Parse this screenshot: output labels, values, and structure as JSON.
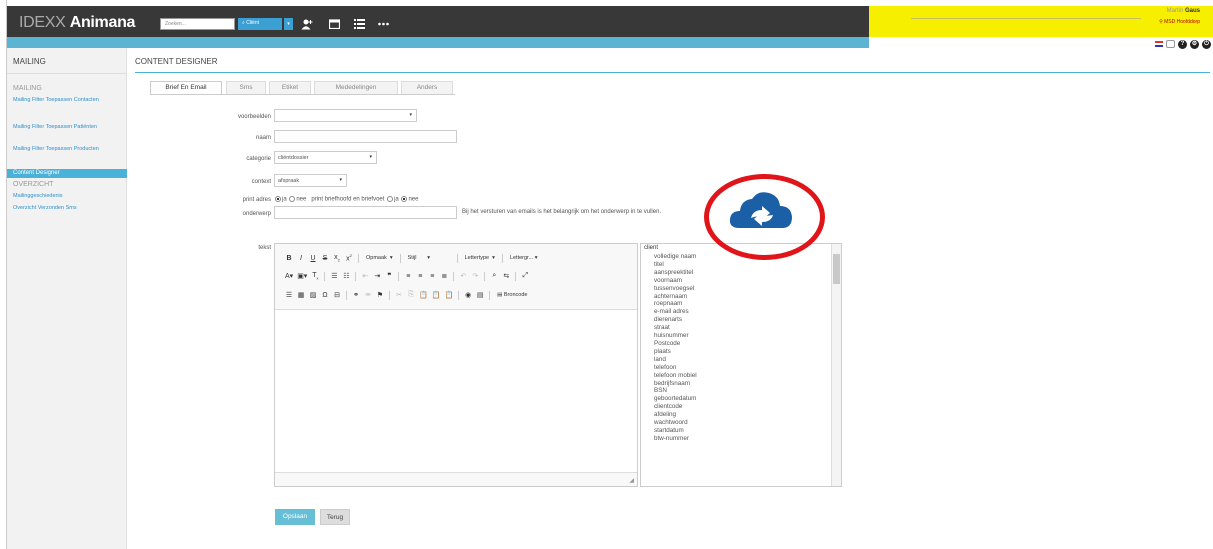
{
  "app": {
    "logo_light": "IDEXX",
    "logo_bold": "Animana"
  },
  "header": {
    "search_placeholder": "Zoeken...",
    "search_scope": "Cliënt",
    "user_first": "Martin",
    "user_last": "Gaus",
    "location": "MSD Hoofddorp"
  },
  "sidebar": {
    "header": "MAILING",
    "group1": "MAILING",
    "links1": [
      "Mailing Filter Toepassen Contacten",
      "Mailing Filter Toepassen Patiënten",
      "Mailing Filter Toepassen Producten"
    ],
    "active": "Content Designer",
    "group2": "OVERZICHT",
    "links2": [
      "Mailinggeschiedenis",
      "Overzicht Verzonden Sms"
    ]
  },
  "main": {
    "title": "CONTENT DESIGNER",
    "tabs": [
      "Brief En Email",
      "Sms",
      "Etiket",
      "Mededelingen",
      "Anders"
    ]
  },
  "form": {
    "voorbeelden_label": "voorbeelden",
    "naam_label": "naam",
    "categorie_label": "categorie",
    "categorie_value": "cliëntdossier",
    "context_label": "context",
    "context_value": "afspraak",
    "print_adres_label": "print adres",
    "ja": "ja",
    "nee": "nee",
    "print_briefhoofd_label": "print briefhoofd en briefvoet",
    "onderwerp_label": "onderwerp",
    "onderwerp_hint": "Bij het versturen van emails is het belangrijk om het onderwerp in te vullen.",
    "tekst_label": "tekst"
  },
  "toolbar": {
    "opmaak": "Opmaak",
    "stijl": "Stijl",
    "lettertype": "Lettertype",
    "lettergrootte": "Lettergr...",
    "broncode": "Broncode"
  },
  "fields": {
    "header": "client",
    "items": [
      "volledige naam",
      "titel",
      "aanspreektitel",
      "voornaam",
      "tussenvoegsel",
      "achternaam",
      "roepnaam",
      "e-mail adres",
      "dierenarts",
      "straat",
      "huisnummer",
      "Postcode",
      "plaats",
      "land",
      "telefoon",
      "telefoon mobiel",
      "bedrijfsnaam",
      "BSN",
      "geboortedatum",
      "clientcode",
      "afdeling",
      "wachtwoord",
      "startdatum",
      "btw-nummer"
    ]
  },
  "buttons": {
    "save": "Opslaan",
    "back": "Terug"
  },
  "colors": {
    "accent": "#4ab1d9",
    "topbar": "#383838",
    "userbar": "#f6ef00",
    "cloud": "#1b5fa6",
    "highlight": "#e0151a"
  }
}
